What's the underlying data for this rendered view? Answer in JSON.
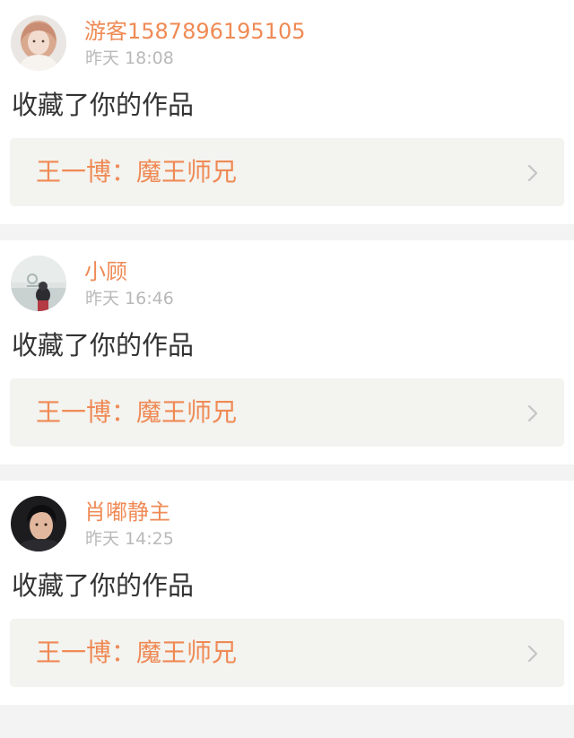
{
  "colors": {
    "accent": "#ef8a55",
    "timestamp": "#b9b9b9",
    "text": "#333333",
    "card_background": "#ffffff",
    "link_background": "#f3f3ef",
    "page_background": "#f3f3f3"
  },
  "icons": {
    "chevron": "chevron-right-icon",
    "avatar": "avatar-image"
  },
  "notifications": [
    {
      "user": "游客1587896195105",
      "time": "昨天 18:08",
      "action": "收藏了你的作品",
      "work_title": "王一博：魔王师兄"
    },
    {
      "user": "小顾",
      "time": "昨天 16:46",
      "action": "收藏了你的作品",
      "work_title": "王一博：魔王师兄"
    },
    {
      "user": "肖嘟静主",
      "time": "昨天 14:25",
      "action": "收藏了你的作品",
      "work_title": "王一博：魔王师兄"
    }
  ]
}
